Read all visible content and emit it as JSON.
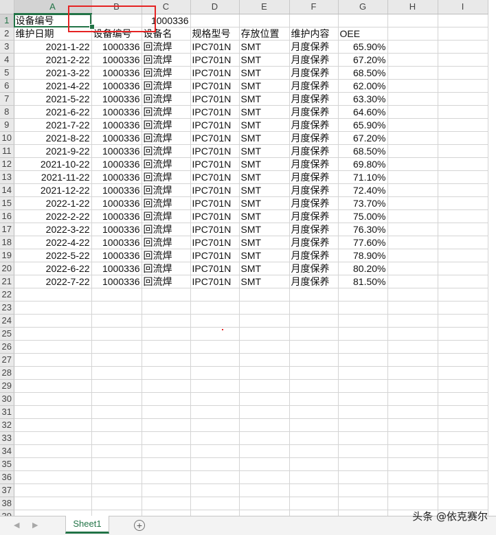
{
  "columns": [
    "A",
    "B",
    "C",
    "D",
    "E",
    "F",
    "G",
    "H",
    "I"
  ],
  "rows": [
    [
      "设备编号",
      "",
      "1000336",
      "",
      "",
      "",
      "",
      "",
      ""
    ],
    [
      "维护日期",
      "设备编号",
      "设备名",
      "规格型号",
      "存放位置",
      "维护内容",
      "OEE",
      "",
      ""
    ],
    [
      "2021-1-22",
      "1000336",
      "回流焊",
      "IPC701N",
      "SMT",
      "月度保养",
      "65.90%",
      "",
      ""
    ],
    [
      "2021-2-22",
      "1000336",
      "回流焊",
      "IPC701N",
      "SMT",
      "月度保养",
      "67.20%",
      "",
      ""
    ],
    [
      "2021-3-22",
      "1000336",
      "回流焊",
      "IPC701N",
      "SMT",
      "月度保养",
      "68.50%",
      "",
      ""
    ],
    [
      "2021-4-22",
      "1000336",
      "回流焊",
      "IPC701N",
      "SMT",
      "月度保养",
      "62.00%",
      "",
      ""
    ],
    [
      "2021-5-22",
      "1000336",
      "回流焊",
      "IPC701N",
      "SMT",
      "月度保养",
      "63.30%",
      "",
      ""
    ],
    [
      "2021-6-22",
      "1000336",
      "回流焊",
      "IPC701N",
      "SMT",
      "月度保养",
      "64.60%",
      "",
      ""
    ],
    [
      "2021-7-22",
      "1000336",
      "回流焊",
      "IPC701N",
      "SMT",
      "月度保养",
      "65.90%",
      "",
      ""
    ],
    [
      "2021-8-22",
      "1000336",
      "回流焊",
      "IPC701N",
      "SMT",
      "月度保养",
      "67.20%",
      "",
      ""
    ],
    [
      "2021-9-22",
      "1000336",
      "回流焊",
      "IPC701N",
      "SMT",
      "月度保养",
      "68.50%",
      "",
      ""
    ],
    [
      "2021-10-22",
      "1000336",
      "回流焊",
      "IPC701N",
      "SMT",
      "月度保养",
      "69.80%",
      "",
      ""
    ],
    [
      "2021-11-22",
      "1000336",
      "回流焊",
      "IPC701N",
      "SMT",
      "月度保养",
      "71.10%",
      "",
      ""
    ],
    [
      "2021-12-22",
      "1000336",
      "回流焊",
      "IPC701N",
      "SMT",
      "月度保养",
      "72.40%",
      "",
      ""
    ],
    [
      "2022-1-22",
      "1000336",
      "回流焊",
      "IPC701N",
      "SMT",
      "月度保养",
      "73.70%",
      "",
      ""
    ],
    [
      "2022-2-22",
      "1000336",
      "回流焊",
      "IPC701N",
      "SMT",
      "月度保养",
      "75.00%",
      "",
      ""
    ],
    [
      "2022-3-22",
      "1000336",
      "回流焊",
      "IPC701N",
      "SMT",
      "月度保养",
      "76.30%",
      "",
      ""
    ],
    [
      "2022-4-22",
      "1000336",
      "回流焊",
      "IPC701N",
      "SMT",
      "月度保养",
      "77.60%",
      "",
      ""
    ],
    [
      "2022-5-22",
      "1000336",
      "回流焊",
      "IPC701N",
      "SMT",
      "月度保养",
      "78.90%",
      "",
      ""
    ],
    [
      "2022-6-22",
      "1000336",
      "回流焊",
      "IPC701N",
      "SMT",
      "月度保养",
      "80.20%",
      "",
      ""
    ],
    [
      "2022-7-22",
      "1000336",
      "回流焊",
      "IPC701N",
      "SMT",
      "月度保养",
      "81.50%",
      "",
      ""
    ],
    [
      "",
      "",
      "",
      "",
      "",
      "",
      "",
      "",
      ""
    ],
    [
      "",
      "",
      "",
      "",
      "",
      "",
      "",
      "",
      ""
    ],
    [
      "",
      "",
      "",
      "",
      "",
      "",
      "",
      "",
      ""
    ],
    [
      "",
      "",
      "",
      "",
      "",
      "",
      "",
      "",
      ""
    ],
    [
      "",
      "",
      "",
      "",
      "",
      "",
      "",
      "",
      ""
    ],
    [
      "",
      "",
      "",
      "",
      "",
      "",
      "",
      "",
      ""
    ],
    [
      "",
      "",
      "",
      "",
      "",
      "",
      "",
      "",
      ""
    ],
    [
      "",
      "",
      "",
      "",
      "",
      "",
      "",
      "",
      ""
    ],
    [
      "",
      "",
      "",
      "",
      "",
      "",
      "",
      "",
      ""
    ],
    [
      "",
      "",
      "",
      "",
      "",
      "",
      "",
      "",
      ""
    ],
    [
      "",
      "",
      "",
      "",
      "",
      "",
      "",
      "",
      ""
    ],
    [
      "",
      "",
      "",
      "",
      "",
      "",
      "",
      "",
      ""
    ],
    [
      "",
      "",
      "",
      "",
      "",
      "",
      "",
      "",
      ""
    ],
    [
      "",
      "",
      "",
      "",
      "",
      "",
      "",
      "",
      ""
    ],
    [
      "",
      "",
      "",
      "",
      "",
      "",
      "",
      "",
      ""
    ],
    [
      "",
      "",
      "",
      "",
      "",
      "",
      "",
      "",
      ""
    ],
    [
      "",
      "",
      "",
      "",
      "",
      "",
      "",
      "",
      ""
    ],
    [
      "",
      "",
      "",
      "",
      "",
      "",
      "",
      "",
      ""
    ],
    [
      "",
      "",
      "",
      "",
      "",
      "",
      "",
      "",
      ""
    ]
  ],
  "selected_cell": "A1",
  "sheet_tabs": [
    "Sheet1"
  ],
  "add_sheet_label": "⊕",
  "nav": {
    "prev": "◀",
    "next": "▶"
  },
  "watermark": "头条 @依克赛尔",
  "colors": {
    "accent": "#217346",
    "annotation": "#e52222",
    "header_bg": "#e9e9e9",
    "gridline": "#d4d4d4"
  }
}
